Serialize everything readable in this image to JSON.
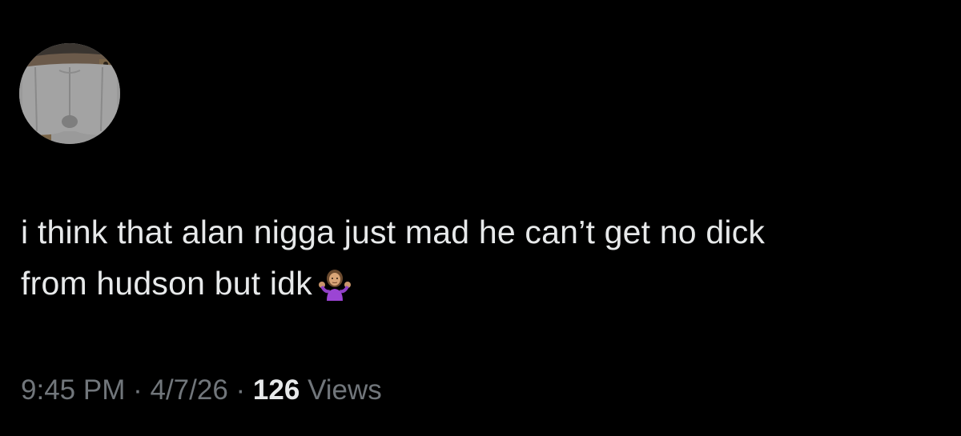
{
  "tweet": {
    "line1": "i think that alan nigga just mad he can’t get no dick",
    "line2": "from hudson but idk",
    "emoji": "person-shrugging-icon"
  },
  "meta": {
    "time": "9:45 PM",
    "sep1": "·",
    "date": "4/7/26",
    "sep2": "·",
    "views_count": "126",
    "views_label": "Views"
  },
  "colors": {
    "background": "#000000",
    "text_primary": "#e7e9ea",
    "text_secondary": "#71767b"
  }
}
